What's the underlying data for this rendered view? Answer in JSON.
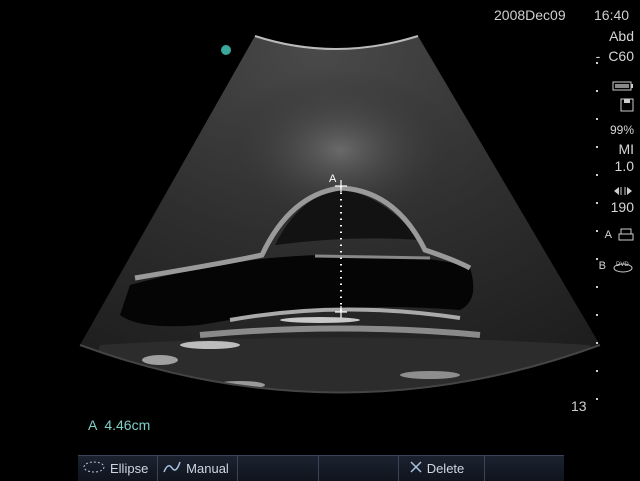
{
  "header": {
    "date": "2008Dec09",
    "time": "16:40"
  },
  "right_panel": {
    "exam": "Abd",
    "transducer": "C60",
    "battery_icon": "battery-icon",
    "save_icon": "disk-icon",
    "battery_pct": "99%",
    "mi_label": "MI",
    "mi_value": "1.0",
    "gain_icon": "gain-icon",
    "gain_value": "190",
    "printer_label": "A",
    "printer_icon": "printer-icon",
    "dvd_label": "B",
    "dvd_icon": "dvd-icon"
  },
  "measurement": {
    "text": "A  4.46cm",
    "caliper_label": "A"
  },
  "depth": "13",
  "softkeys": [
    {
      "label": "Ellipse",
      "icon": "ellipse-icon"
    },
    {
      "label": "Manual",
      "icon": "manual-trace-icon"
    },
    {
      "label": ""
    },
    {
      "label": ""
    },
    {
      "label": "Delete",
      "icon": "delete-x-icon"
    },
    {
      "label": ""
    }
  ],
  "colors": {
    "accent": "#7fd0c7",
    "marker": "#3aa89a"
  }
}
